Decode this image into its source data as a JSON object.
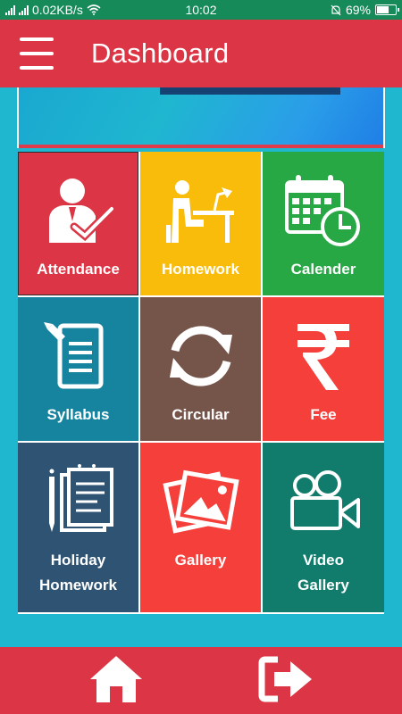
{
  "status_bar": {
    "network_speed": "0.02KB/s",
    "time": "10:02",
    "battery": "69%",
    "battery_level": 0.69
  },
  "header": {
    "title": "Dashboard"
  },
  "tiles": [
    {
      "label": "Attendance",
      "color": "#dc3545",
      "icon": "attendance-icon"
    },
    {
      "label": "Homework",
      "color": "#f9bc0a",
      "icon": "homework-icon"
    },
    {
      "label": "Calender",
      "color": "#27a844",
      "icon": "calendar-icon"
    },
    {
      "label": "Syllabus",
      "color": "#16849e",
      "icon": "syllabus-icon"
    },
    {
      "label": "Circular",
      "color": "#75544a",
      "icon": "circular-icon"
    },
    {
      "label": "Fee",
      "color": "#f43f3a",
      "icon": "rupee-icon"
    },
    {
      "label": "Holiday Homework",
      "label_lines": [
        "Holiday",
        "Homework"
      ],
      "color": "#2f5372",
      "icon": "holiday-homework-icon"
    },
    {
      "label": "Gallery",
      "color": "#f43f3a",
      "icon": "gallery-icon"
    },
    {
      "label": "Video Gallery",
      "label_lines": [
        "Video",
        "Gallery"
      ],
      "color": "#117c6c",
      "icon": "video-gallery-icon"
    }
  ],
  "bottom_nav": {
    "home_icon": "home-icon",
    "logout_icon": "logout-icon"
  },
  "colors": {
    "primary": "#dc3545",
    "status_bar": "#178a5a",
    "background": "#1fb6d0"
  }
}
